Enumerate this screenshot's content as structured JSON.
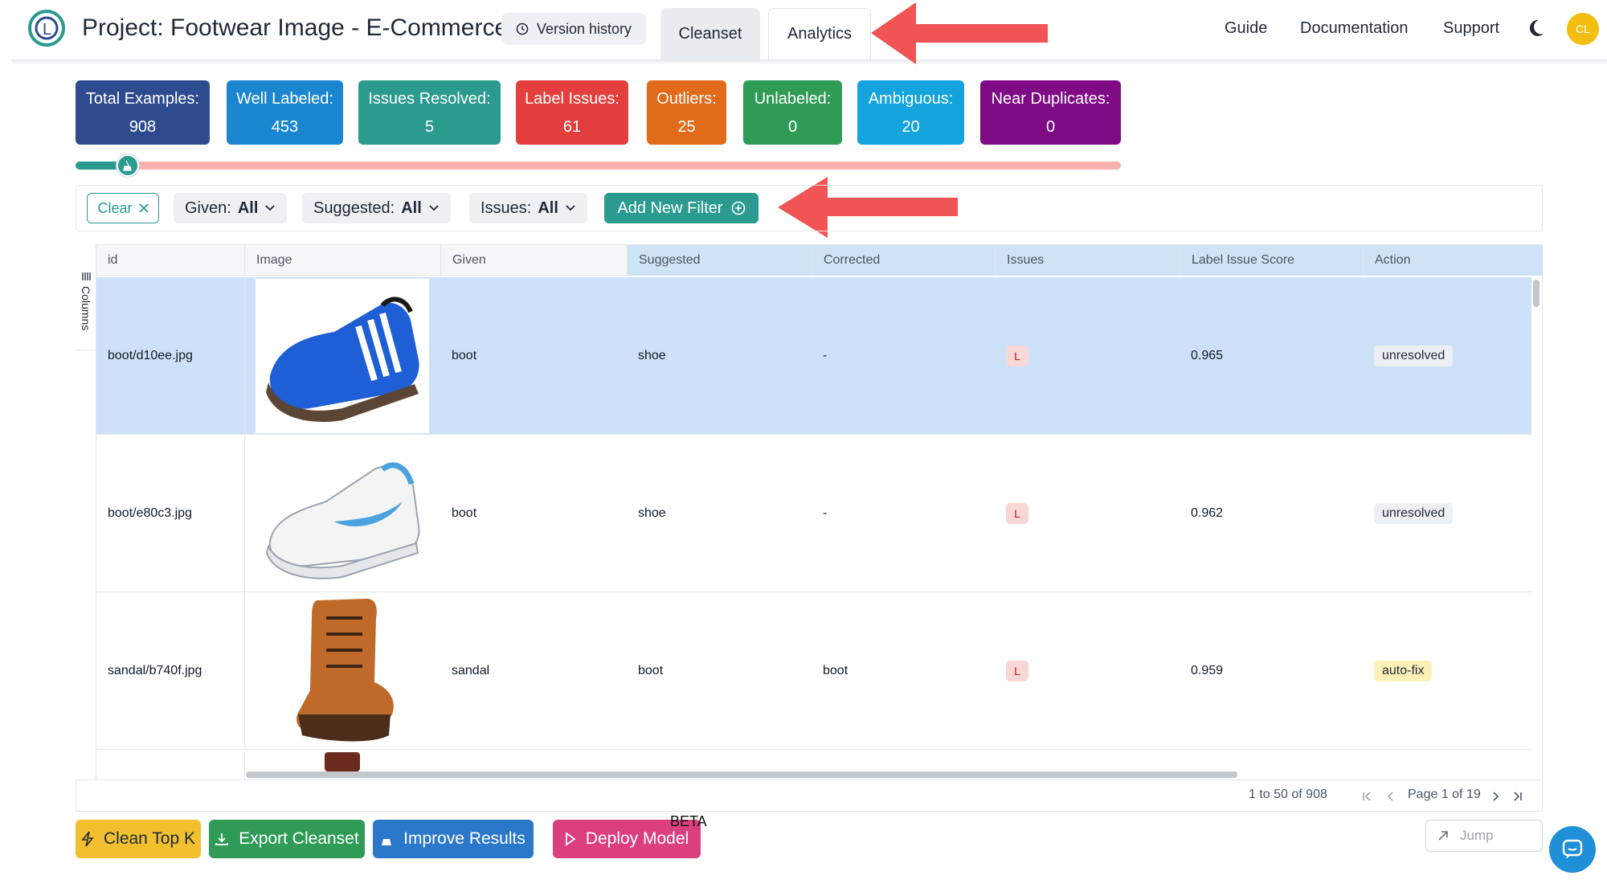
{
  "header": {
    "project_title": "Project: Footwear Image - E-Commerce",
    "version_history": "Version history",
    "tabs": [
      {
        "label": "Cleanset",
        "active": true
      },
      {
        "label": "Analytics",
        "active": false
      }
    ],
    "nav": [
      "Guide",
      "Documentation",
      "Support"
    ],
    "avatar_initials": "CL"
  },
  "stats": [
    {
      "label": "Total Examples:",
      "value": "908",
      "color": "#2f4b8f"
    },
    {
      "label": "Well Labeled:",
      "value": "453",
      "color": "#1a86cf"
    },
    {
      "label": "Issues Resolved:",
      "value": "5",
      "color": "#2b9a8f"
    },
    {
      "label": "Label Issues:",
      "value": "61",
      "color": "#e53e3e"
    },
    {
      "label": "Outliers:",
      "value": "25",
      "color": "#e26a1b"
    },
    {
      "label": "Unlabeled:",
      "value": "0",
      "color": "#2f9b57"
    },
    {
      "label": "Ambiguous:",
      "value": "20",
      "color": "#14a3dc"
    },
    {
      "label": "Near Duplicates:",
      "value": "0",
      "color": "#7e0a86"
    }
  ],
  "progress": {
    "resolved_fraction": 0.05
  },
  "filters": {
    "clear_label": "Clear",
    "items": [
      {
        "name": "Given:",
        "value": "All"
      },
      {
        "name": "Suggested:",
        "value": "All"
      },
      {
        "name": "Issues:",
        "value": "All"
      }
    ],
    "add_label": "Add New Filter"
  },
  "table": {
    "columns_toggle": "Columns",
    "headers": [
      "id",
      "Image",
      "Given",
      "Suggested",
      "Corrected",
      "Issues",
      "Label Issue Score",
      "Action"
    ],
    "rows": [
      {
        "id": "boot/d10ee.jpg",
        "image": "blue-sneaker",
        "given": "boot",
        "suggested": "shoe",
        "corrected": "-",
        "issue": "L",
        "score": "0.965",
        "action": "unresolved"
      },
      {
        "id": "boot/e80c3.jpg",
        "image": "white-sneaker",
        "given": "boot",
        "suggested": "shoe",
        "corrected": "-",
        "issue": "L",
        "score": "0.962",
        "action": "unresolved"
      },
      {
        "id": "sandal/b740f.jpg",
        "image": "brown-boot",
        "given": "sandal",
        "suggested": "boot",
        "corrected": "boot",
        "issue": "L",
        "score": "0.959",
        "action": "auto-fix"
      }
    ],
    "row_count_text": "1 to 50 of 908",
    "page_text": "Page 1 of 19"
  },
  "actions": {
    "clean_top_k": "Clean Top K",
    "export": "Export Cleanset",
    "improve": "Improve Results",
    "deploy": "Deploy Model",
    "beta": "BETA",
    "jump_placeholder": "Jump"
  }
}
